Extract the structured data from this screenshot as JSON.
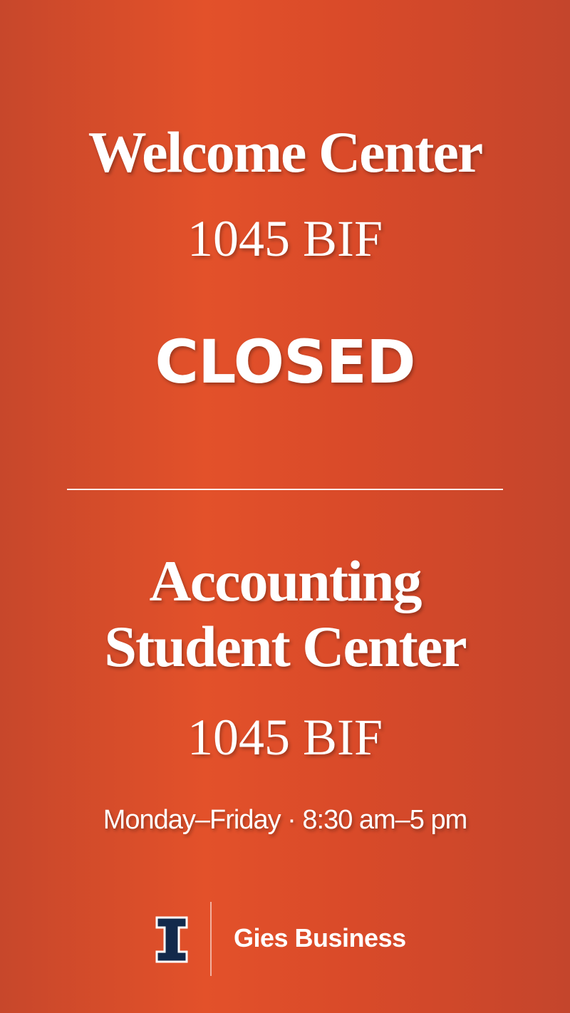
{
  "welcome_center": {
    "title": "Welcome Center",
    "room": "1045 BIF",
    "status": "CLOSED"
  },
  "accounting_student_center": {
    "title_line1": "Accounting",
    "title_line2": "Student Center",
    "room": "1045 BIF",
    "hours": "Monday–Friday · 8:30 am–5 pm"
  },
  "footer": {
    "logo_icon": "block-i-logo-icon",
    "brand_name": "Gies Business",
    "colors": {
      "logo_fill": "#13294b",
      "logo_outline": "#ffffff"
    }
  },
  "colors": {
    "background": "#e3512a",
    "text": "#ffffff"
  }
}
